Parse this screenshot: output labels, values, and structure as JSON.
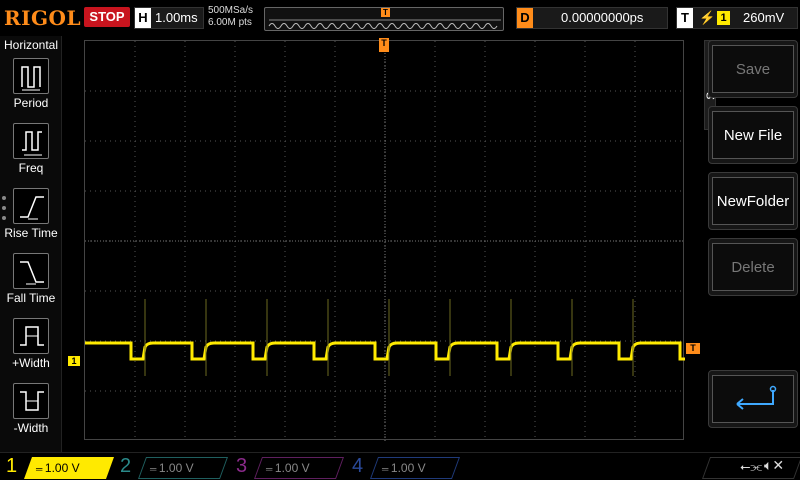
{
  "topbar": {
    "logo": "RIGOL",
    "run_status": "STOP",
    "horizontal_key": "H",
    "timebase": "1.00ms",
    "sample_rate": "500MSa/s",
    "memory_depth": "6.00M pts",
    "trigger_marker": "T",
    "delay_key": "D",
    "delay_value": "0.00000000ps",
    "trigger_key": "T",
    "trigger_edge": "⚡",
    "trigger_channel": "1",
    "trigger_level": "260mV"
  },
  "left_menu": {
    "title": "Horizontal",
    "items": [
      {
        "label": "Period",
        "icon": "period-icon"
      },
      {
        "label": "Freq",
        "icon": "freq-icon"
      },
      {
        "label": "Rise Time",
        "icon": "rise-time-icon"
      },
      {
        "label": "Fall Time",
        "icon": "fall-time-icon"
      },
      {
        "label": "+Width",
        "icon": "positive-width-icon"
      },
      {
        "label": "-Width",
        "icon": "negative-width-icon"
      }
    ]
  },
  "screen": {
    "ch1_marker": "1",
    "trigger_top_marker": "T",
    "trigger_level_marker": "T",
    "trace_color": "#ffea00",
    "grid_color": "#555555"
  },
  "right_menu": {
    "tab_label": "Save",
    "buttons": [
      {
        "label": "Save",
        "enabled": false
      },
      {
        "label": "New File",
        "enabled": true
      },
      {
        "label": "NewFolder",
        "enabled": true
      },
      {
        "label": "Delete",
        "enabled": false
      },
      {
        "label": "",
        "icon": "enter-icon",
        "enabled": true
      }
    ]
  },
  "bottombar": {
    "channels": [
      {
        "num": "1",
        "scale": "1.00 V",
        "color": "#ffea00",
        "active": true
      },
      {
        "num": "2",
        "scale": "1.00 V",
        "color": "#00c8c8",
        "active": false
      },
      {
        "num": "3",
        "scale": "1.00 V",
        "color": "#d040d0",
        "active": false
      },
      {
        "num": "4",
        "scale": "1.00 V",
        "color": "#3070ff",
        "active": false
      }
    ],
    "usb_icon": "usb-icon",
    "speaker_icon": "speaker-muted-icon"
  }
}
